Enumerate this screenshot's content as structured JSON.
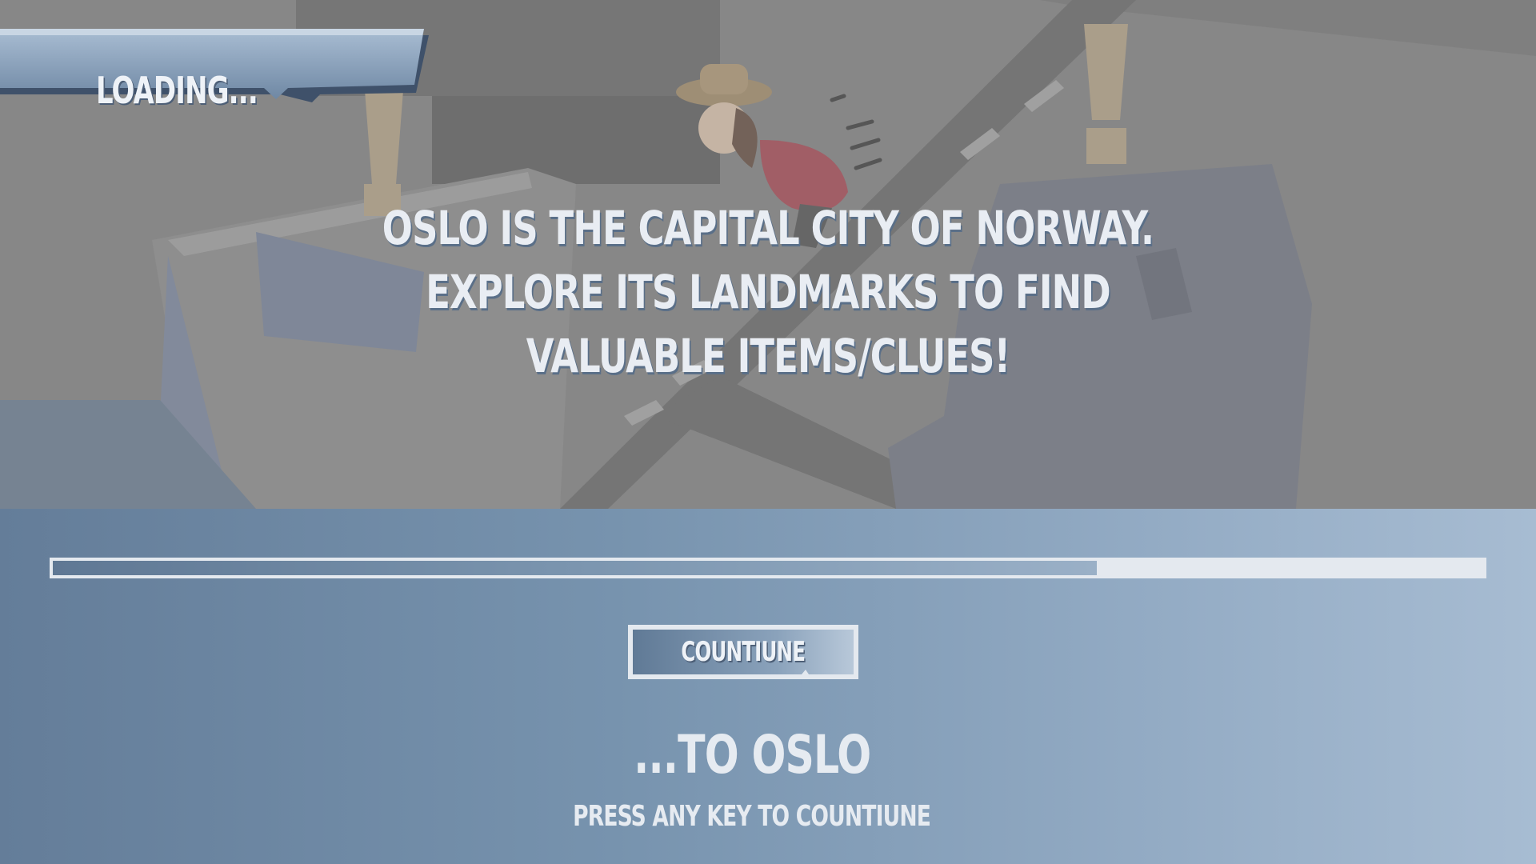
{
  "banner": {
    "label": "LOADING..."
  },
  "tip": {
    "lines": [
      "OSLO IS THE CAPITAL CITY OF NORWAY.",
      "EXPLORE ITS LANDMARKS TO FIND",
      "VALUABLE ITEMS/CLUES!"
    ]
  },
  "progress": {
    "fraction": 0.73
  },
  "continue_button": {
    "label": "COUNTIUNE"
  },
  "destination": {
    "title": "...TO OSLO"
  },
  "hint": {
    "text": "PRESS ANY KEY TO COUNTIUNE"
  },
  "colors": {
    "panel_dark": "#647d99",
    "panel_light": "#a7bcd2",
    "text_light": "#e6ebf1",
    "exclamation": "#b5a48a"
  }
}
